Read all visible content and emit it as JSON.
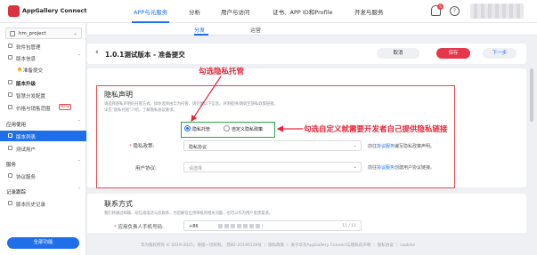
{
  "topnav": {
    "logo_text": "AppGallery Connect",
    "items": [
      "APP与元服务",
      "分析",
      "用户与访问",
      "证书、APP ID和Profile",
      "开发与服务"
    ],
    "bell_badge": "5",
    "help_icon": "?"
  },
  "sidebar": {
    "project": "hm_project",
    "items": {
      "software_pkg": "软件包管理",
      "version_info": "版本信息",
      "pending_submit": "准备提交",
      "version_upgrade": "版本升级",
      "smart_dist": "智慧分发配置",
      "price_sales": "价格与销售范围",
      "price_tag": "New",
      "app_usage": "应用使用",
      "version_list": "版本列表",
      "test_users": "测试用户",
      "service": "服务",
      "agreement_service": "协议服务",
      "records": "记录跟踪",
      "version_history": "版本历史记录"
    },
    "fold_button": "全部功能"
  },
  "subtabs": [
    "分发",
    "运营"
  ],
  "header": {
    "title": "1.0.1测试版本 - 准备提交",
    "cancel": "取消",
    "save": "保存",
    "next": "下一步"
  },
  "privacy": {
    "title": "隐私声明",
    "desc_1": "请选择隐私声明的托管方式。如你选择由华为托管，请完善以下信息，声明提供/跳转至隐私政策链接。",
    "desc_2": "详见“隐私托管”介绍，了解隐私协议要求。",
    "radio_hosted": "隐私托管",
    "radio_custom": "自定义隐私政策",
    "policy_label": "隐私政策:",
    "policy_value": "隐私协议",
    "policy_hint_prefix": "前往",
    "policy_hint_link": "协议服务",
    "policy_hint_suffix": "编写隐私政策声明。",
    "user_agreement_label": "用户协议:",
    "user_agreement_placeholder": "请选择",
    "user_hint_prefix": "前往",
    "user_hint_link": "协议服务",
    "user_hint_suffix": "创建用户协议链接。"
  },
  "annotations": {
    "hosted": "勾选隐私托管",
    "custom": "勾选自定义就需要开发者自己提供隐私链接"
  },
  "contact": {
    "title": "联系方式",
    "desc": "我们将通过邮箱、短信或电话与您联系，为您解答应用审核的相关问题，也可以作为用户反馈渠道。",
    "phone_label": "应用负责人手机号码:",
    "phone_prefix": "+86",
    "phone_count": "11 / 11"
  },
  "footer": {
    "text": "华为版权所有 © 2019-2025。保留一切权利。 苏B2-20190128号 ｜ 隐私政策 ｜ 关于华为AppGallery Connect与隐私的声明 ｜ 隐私协议 ｜ cookies"
  },
  "colors": {
    "primary": "#1f6feb",
    "danger": "#e5484d",
    "annotation": "#e5263a",
    "radio_box": "#2aa84a"
  }
}
